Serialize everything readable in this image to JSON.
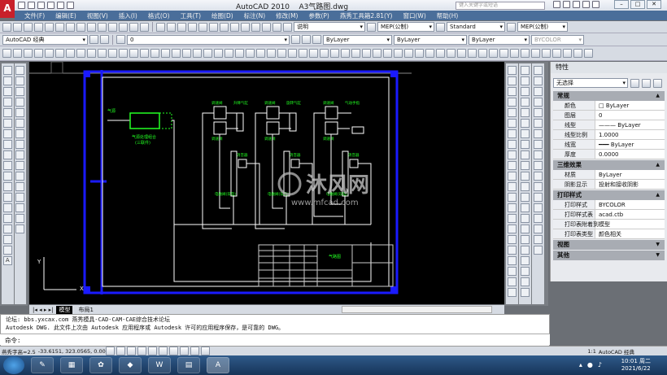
{
  "app": {
    "title": "AutoCAD 2010",
    "document": "A3气路图.dwg",
    "search_placeholder": "键入关键字或短语",
    "logo": "A"
  },
  "window_controls": [
    "–",
    "□",
    "✕"
  ],
  "menu": [
    "文件(F)",
    "编辑(E)",
    "视图(V)",
    "插入(I)",
    "格式(O)",
    "工具(T)",
    "绘图(D)",
    "标注(N)",
    "修改(M)",
    "参数(P)",
    "燕秀工具箱2.81(Y)",
    "窗口(W)",
    "帮助(H)"
  ],
  "toolbar": {
    "text_style": "说明",
    "dim_style": "MEP(公制)",
    "table_style": "Standard",
    "mleader_style": "MEP(公制)",
    "workspace": "AutoCAD 经典",
    "layer": "0",
    "color": "ByLayer",
    "linetype": "ByLayer",
    "lineweight": "ByLayer",
    "plotstyle": "BYCOLOR"
  },
  "left_tools": [
    "line",
    "xline",
    "pline",
    "polygon",
    "rectangle",
    "arc",
    "circle",
    "revcloud",
    "spline",
    "ellipse",
    "ellipse-arc",
    "insert-block",
    "make-block",
    "point",
    "hatch",
    "gradient",
    "region",
    "table",
    "mtext"
  ],
  "modify_tools": [
    "erase",
    "copy",
    "mirror",
    "offset",
    "array",
    "move",
    "rotate",
    "scale",
    "stretch",
    "trim",
    "extend",
    "break",
    "join",
    "chamfer",
    "fillet",
    "explode"
  ],
  "properties": {
    "title": "特性",
    "selection": "无选择",
    "sections": [
      {
        "name": "常规",
        "rows": [
          [
            "颜色",
            "□ ByLayer"
          ],
          [
            "图层",
            "0"
          ],
          [
            "线型",
            "——— ByLayer"
          ],
          [
            "线型比例",
            "1.0000"
          ],
          [
            "线宽",
            "━━━ ByLayer"
          ],
          [
            "厚度",
            "0.0000"
          ]
        ]
      },
      {
        "name": "三维效果",
        "rows": [
          [
            "材质",
            "ByLayer"
          ],
          [
            "阴影显示",
            "投射和接收阴影"
          ]
        ]
      },
      {
        "name": "打印样式",
        "rows": [
          [
            "打印样式",
            "BYCOLOR"
          ],
          [
            "打印样式表",
            "acad.ctb"
          ],
          [
            "打印表附着到",
            "模型"
          ],
          [
            "打印表类型",
            "颜色相关"
          ]
        ]
      },
      {
        "name": "视图",
        "rows": []
      },
      {
        "name": "其他",
        "rows": []
      }
    ]
  },
  "drawing": {
    "labels": {
      "air_source": "气源",
      "frl_unit": "气源处理组合",
      "frl_sub": "(三联件)",
      "speed_valve": "调速阀",
      "lift_cyl": "升降气缸",
      "rot_cyl": "旋转气缸",
      "gripper": "气动手指",
      "muffler": "消音器",
      "solenoid": "电磁阀(双电)",
      "title_block": "气路图",
      "axis_x": "X",
      "axis_y": "Y"
    },
    "watermark": {
      "brand": "沐风网",
      "url": "www.mfcad.com"
    },
    "colors": {
      "frame": "#1a1aff",
      "lines": "#ffffff",
      "text": "#22ff22",
      "titleblock_text": "#ff44ff",
      "background": "#000000"
    }
  },
  "layout_tabs": [
    "模型",
    "布局1"
  ],
  "command": {
    "history": [
      "论坛: bbs.yxcax.com     燕秀模具-CAD-CAM-CAE综合技术论坛",
      "Autodesk DWG.  此文件上次由 Autodesk 应用程序或 Autodesk 许可的应用程序保存，是可靠的 DWG。"
    ],
    "prompt": "命令:"
  },
  "status": {
    "text_height": "燕秀字高=2.5",
    "coords": "-33.6151, 323.0565, 0.0000",
    "scale": "1:1",
    "workspace": "AutoCAD 经典"
  },
  "taskbar": {
    "time": "10:01 周二",
    "date": "2021/6/22"
  }
}
